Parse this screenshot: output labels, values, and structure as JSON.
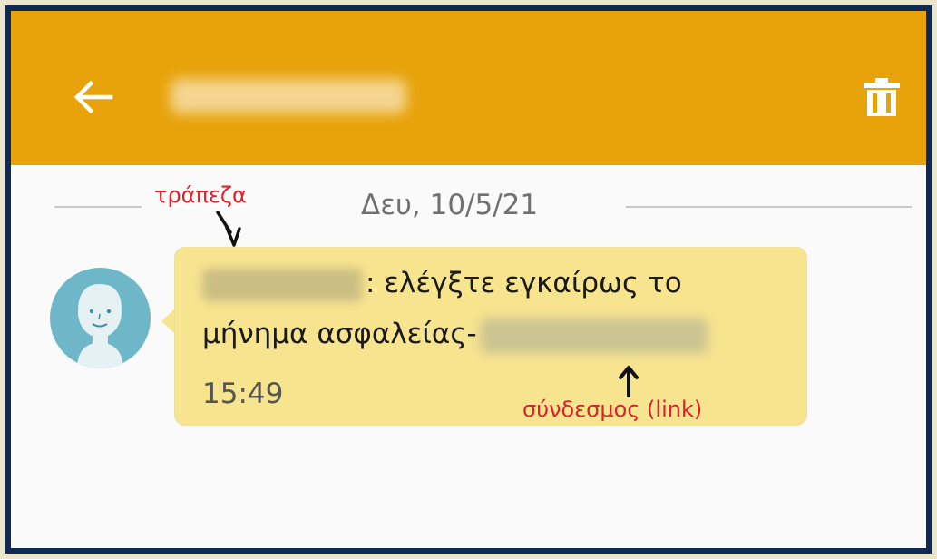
{
  "appbar": {
    "back_icon": "arrow-left-icon",
    "delete_icon": "trash-icon",
    "background": "#e8a30b"
  },
  "conversation": {
    "date_separator": "Δευ, 10/5/21",
    "message": {
      "text_part1": ": ελέγξτε εγκαίρως το",
      "text_part2": "μήνημα ασφαλείας-",
      "time": "15:49",
      "bubble_color": "#f7e48f"
    }
  },
  "annotations": {
    "bank_label": "τράπεζα",
    "link_label": "σύνδεσμος (link)",
    "color": "#d8232a"
  }
}
